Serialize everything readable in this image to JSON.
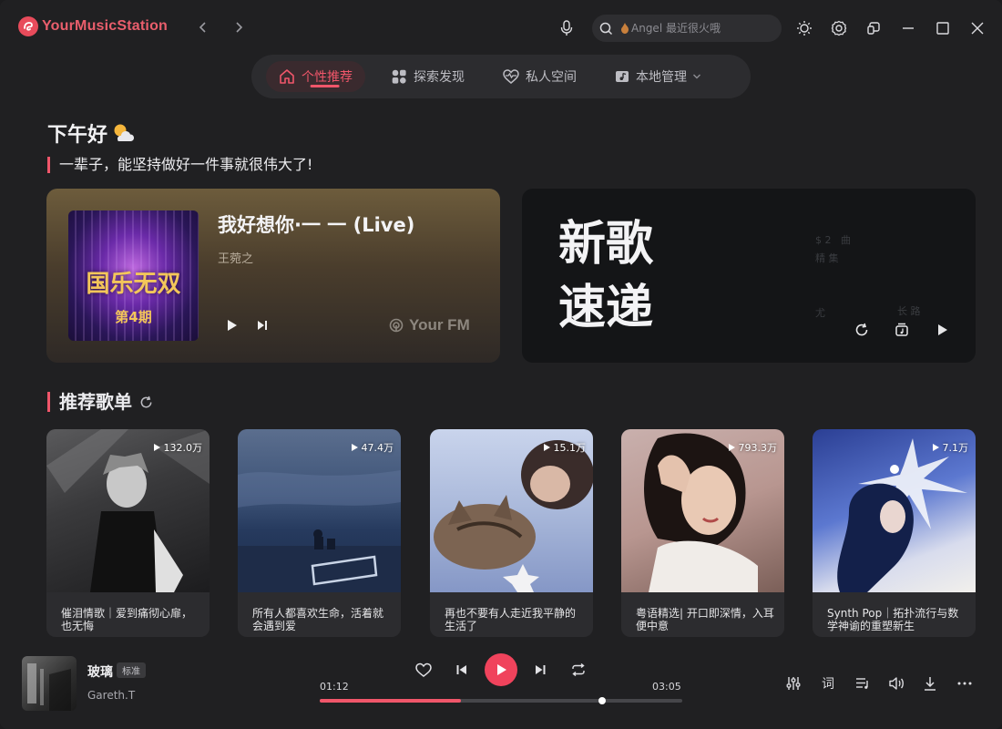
{
  "app": {
    "name": "YourMusicStation"
  },
  "search": {
    "placeholder": "Angel 最近很火哦"
  },
  "tabs": [
    {
      "label": "个性推荐",
      "active": true
    },
    {
      "label": "探索发现",
      "active": false
    },
    {
      "label": "私人空间",
      "active": false
    },
    {
      "label": "本地管理",
      "active": false
    }
  ],
  "greeting": {
    "text": "下午好",
    "quote": "一辈子，能坚持做好一件事就很伟大了!"
  },
  "fm": {
    "title": "我好想你·一 一 (Live)",
    "artist": "王菀之",
    "cover_text": "国乐无双",
    "cover_sub": "第4期",
    "brand": "Your FM"
  },
  "new_songs": {
    "title": "新歌速递"
  },
  "playlists_section": {
    "title": "推荐歌单"
  },
  "playlists": [
    {
      "name": "催泪情歌｜爱到痛彻心扉，也无悔",
      "plays": "132.0万"
    },
    {
      "name": "所有人都喜欢生命，活着就会遇到爱",
      "plays": "47.4万"
    },
    {
      "name": "再也不要有人走近我平静的生活了",
      "plays": "15.1万"
    },
    {
      "name": "粤语精选| 开口即深情，入耳便中意",
      "plays": "793.3万"
    },
    {
      "name": "Synth Pop｜拓扑流行与数学神谕的重塑新生",
      "plays": "7.1万"
    }
  ],
  "player": {
    "song": "玻璃",
    "quality": "标准",
    "artist": "Gareth.T",
    "current_time": "01:12",
    "total_time": "03:05",
    "progress": 0.39,
    "volume_pos": 0.78,
    "lyrics_label": "词"
  },
  "colors": {
    "accent": "#f0566a",
    "background": "#202022"
  }
}
